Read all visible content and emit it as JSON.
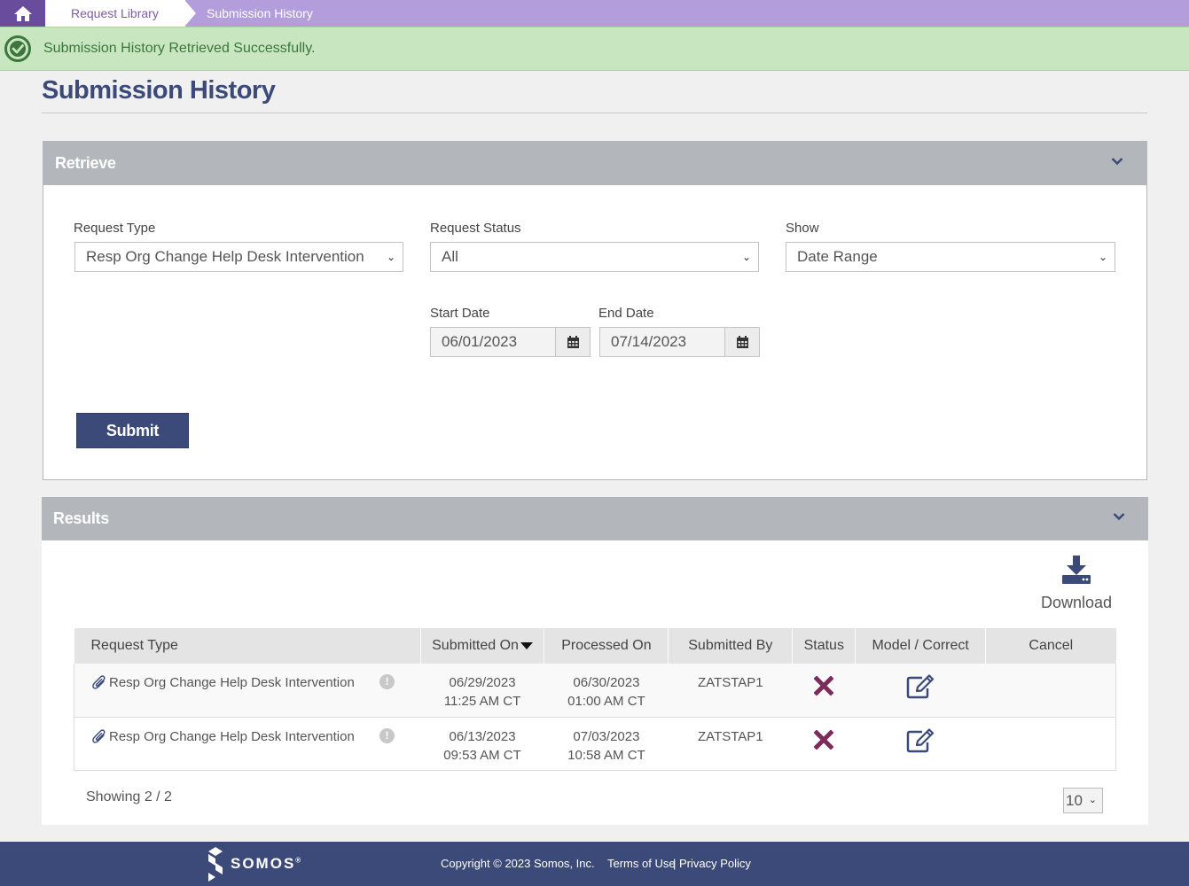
{
  "breadcrumb": {
    "home_icon": "home-icon",
    "items": [
      "Request Library",
      "Submission History"
    ]
  },
  "alert": {
    "icon": "check-circle-icon",
    "message": "Submission History Retrieved Successfully."
  },
  "page_title": "Submission History",
  "retrieve": {
    "header": "Retrieve",
    "request_type_label": "Request Type",
    "request_type_value": "Resp Org Change Help Desk Intervention",
    "request_status_label": "Request Status",
    "request_status_value": "All",
    "show_label": "Show",
    "show_value": "Date Range",
    "start_date_label": "Start Date",
    "start_date_value": "06/01/2023",
    "end_date_label": "End Date",
    "end_date_value": "07/14/2023",
    "submit_label": "Submit"
  },
  "results": {
    "header": "Results",
    "download_label": "Download",
    "columns": [
      "Request Type",
      "Submitted On",
      "Processed On",
      "Submitted By",
      "Status",
      "Model / Correct",
      "Cancel"
    ],
    "rows": [
      {
        "request_type": "Resp Org Change Help Desk Intervention",
        "submitted_date": "06/29/2023",
        "submitted_time": "11:25 AM CT",
        "processed_date": "06/30/2023",
        "processed_time": "01:00 AM CT",
        "submitted_by": "ZATSTAP1",
        "status_icon": "x-icon"
      },
      {
        "request_type": "Resp Org Change Help Desk Intervention",
        "submitted_date": "06/13/2023",
        "submitted_time": "09:53 AM CT",
        "processed_date": "07/03/2023",
        "processed_time": "10:58 AM CT",
        "submitted_by": "ZATSTAP1",
        "status_icon": "x-icon"
      }
    ],
    "showing": "Showing 2 / 2",
    "page_size": "10"
  },
  "footer": {
    "logo_text": "SOMOS",
    "copyright": "Copyright © 2023 Somos, Inc.",
    "terms": "Terms of Use",
    "separator": "|",
    "privacy": "Privacy Policy"
  },
  "colors": {
    "brand": "#3b4a79",
    "breadcrumb_bar": "#b39ddb",
    "success_bg": "#c8e6c0",
    "status_error": "#7b2c5a"
  }
}
